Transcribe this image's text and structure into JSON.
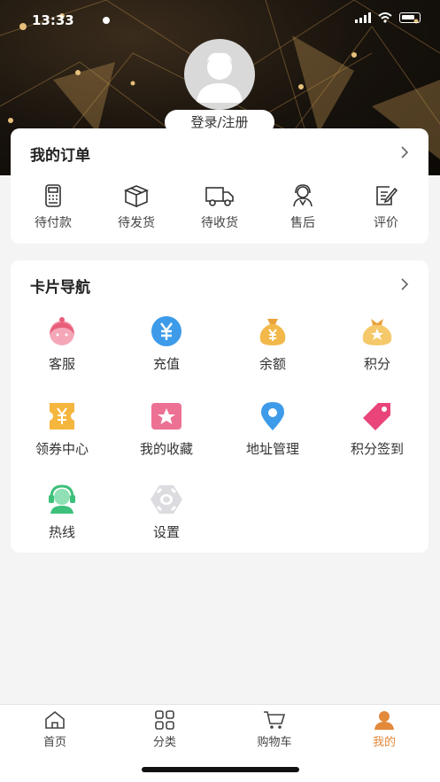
{
  "status_bar": {
    "time": "13:33"
  },
  "header": {
    "login_label": "登录/注册"
  },
  "orders": {
    "title": "我的订单",
    "items": [
      {
        "label": "待付款",
        "icon": "payment-terminal-icon"
      },
      {
        "label": "待发货",
        "icon": "package-box-icon"
      },
      {
        "label": "待收货",
        "icon": "delivery-truck-icon"
      },
      {
        "label": "售后",
        "icon": "customer-service-agent-icon"
      },
      {
        "label": "评价",
        "icon": "edit-review-icon"
      }
    ]
  },
  "card_nav": {
    "title": "卡片导航",
    "items": [
      {
        "label": "客服",
        "icon": "customer-service-icon",
        "color": "#f0708a"
      },
      {
        "label": "充值",
        "icon": "yuan-recharge-icon",
        "color": "#3d9be9"
      },
      {
        "label": "余额",
        "icon": "money-bag-icon",
        "color": "#f2b94a"
      },
      {
        "label": "积分",
        "icon": "points-bag-icon",
        "color": "#f2c15a"
      },
      {
        "label": "领券中心",
        "icon": "coupon-icon",
        "color": "#f5b63e"
      },
      {
        "label": "我的收藏",
        "icon": "favorite-star-icon",
        "color": "#ec7193"
      },
      {
        "label": "地址管理",
        "icon": "location-pin-icon",
        "color": "#3d9be9"
      },
      {
        "label": "积分签到",
        "icon": "tag-icon",
        "color": "#e9457a"
      },
      {
        "label": "热线",
        "icon": "hotline-headset-icon",
        "color": "#3dc07a"
      },
      {
        "label": "设置",
        "icon": "settings-gear-icon",
        "color": "#d8d8dc"
      }
    ]
  },
  "tabbar": {
    "items": [
      {
        "label": "首页",
        "icon": "home-icon"
      },
      {
        "label": "分类",
        "icon": "category-grid-icon"
      },
      {
        "label": "购物车",
        "icon": "cart-icon"
      },
      {
        "label": "我的",
        "icon": "user-icon"
      }
    ],
    "active_index": 3,
    "active_color": "#e3893a"
  }
}
